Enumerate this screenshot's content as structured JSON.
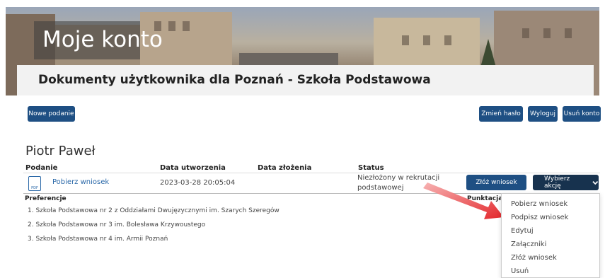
{
  "banner": {
    "title": "Moje konto",
    "subtitle": "Dokumenty użytkownika dla Poznań - Szkoła Podstawowa"
  },
  "toolbar": {
    "new_application": "Nowe podanie",
    "change_password": "Zmień hasło",
    "logout": "Wyloguj",
    "delete_account": "Usuń konto"
  },
  "user": {
    "name": "Piotr Paweł"
  },
  "table": {
    "headers": {
      "application": "Podanie",
      "created": "Data utworzenia",
      "submitted": "Data złożenia",
      "status": "Status"
    },
    "row": {
      "download": "Pobierz wniosek",
      "created": "2023-03-28 20:05:04",
      "submitted": "",
      "status": "Niezłożony w rekrutacji podstawowej",
      "submit_button": "Złóż wniosek",
      "action_button": "Wybierz akcję"
    }
  },
  "preferences": {
    "header": "Preferencje",
    "points_header": "Punktacja",
    "items": [
      "1. Szkoła Podstawowa nr 2 z Oddziałami Dwujęzycznymi im. Szarych Szeregów",
      "2. Szkoła Podstawowa nr 3 im. Bolesława Krzywoustego",
      "3. Szkoła Podstawowa nr 4 im. Armii Poznań"
    ]
  },
  "menu": {
    "items": [
      "Pobierz wniosek",
      "Podpisz wniosek",
      "Edytuj",
      "Załączniki",
      "Złóż wniosek",
      "Usuń"
    ]
  },
  "icons": {
    "file": "pdf-file-icon",
    "chevron": "chevron-down-icon",
    "pointer": "red-arrow-icon"
  },
  "colors": {
    "primary": "#1e4f83",
    "dark": "#17324e",
    "link": "#2a68a8",
    "arrow": "#e3262a"
  }
}
